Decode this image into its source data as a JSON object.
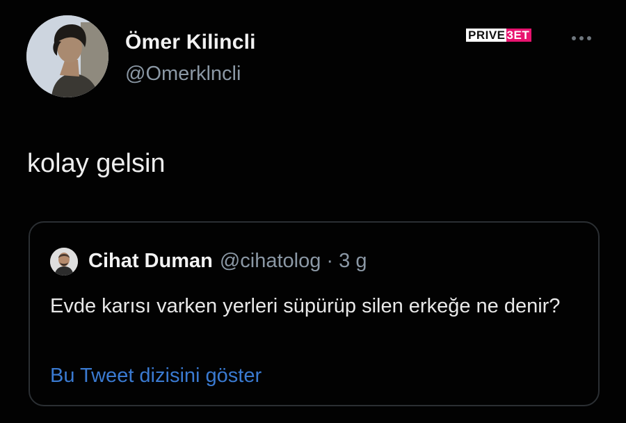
{
  "tweet": {
    "author": {
      "display_name": "Ömer Kilincli",
      "handle": "@Omerklncli"
    },
    "text": "kolay gelsin",
    "more_icon": "more-horizontal-icon"
  },
  "watermark": {
    "part1": "PRIVE",
    "part2": "3ET",
    "colors": {
      "part1_bg": "#ffffff",
      "part2_bg": "#e8136f"
    }
  },
  "quoted_tweet": {
    "author": {
      "display_name": "Cihat Duman",
      "handle": "@cihatolog"
    },
    "meta": "@cihatolog · 3 g",
    "text": "Evde karısı varken yerleri süpürüp silen erkeğe ne denir?",
    "show_thread_link": "Bu Tweet dizisini göster"
  },
  "colors": {
    "background": "#020202",
    "primary_text": "#e7e9ea",
    "secondary_text": "#8b98a5",
    "link": "#3a7ad1",
    "border": "#2b2f33"
  }
}
